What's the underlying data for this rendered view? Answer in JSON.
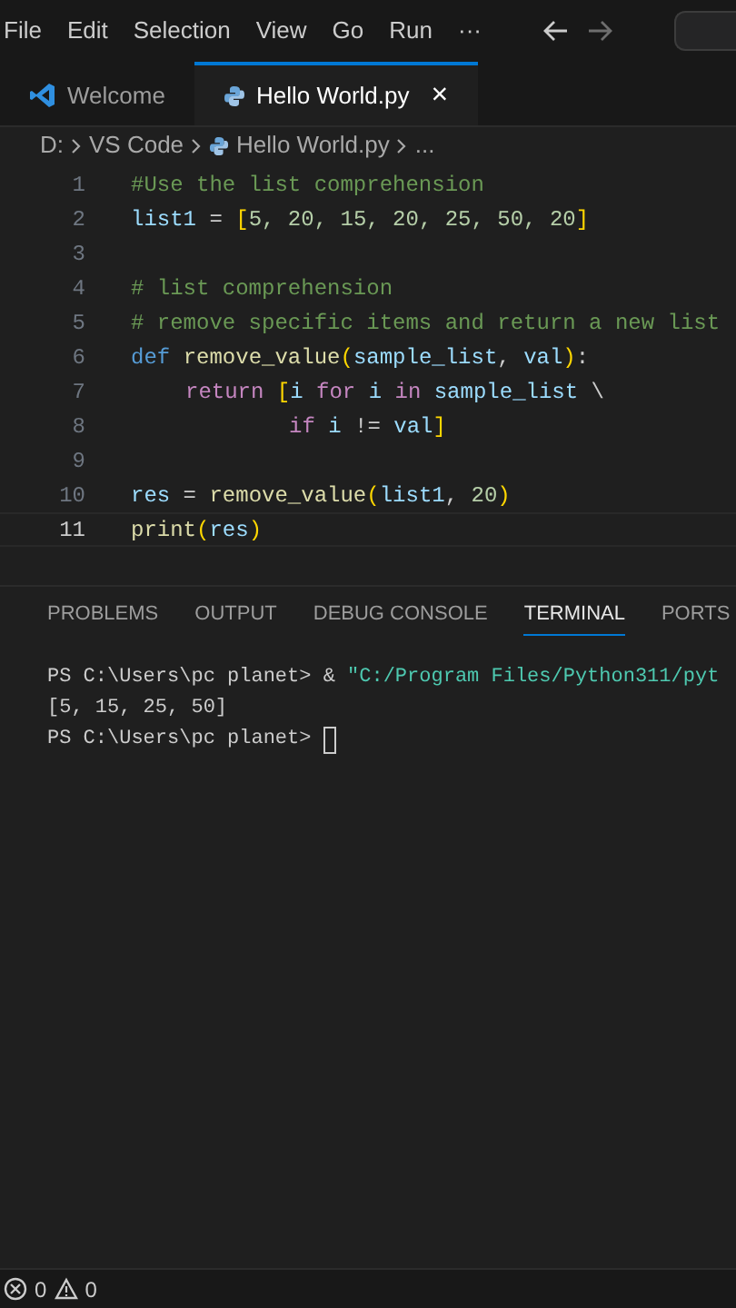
{
  "menu": [
    "File",
    "Edit",
    "Selection",
    "View",
    "Go",
    "Run",
    "···"
  ],
  "tabs": [
    {
      "label": "Welcome",
      "kind": "welcome",
      "selected": false
    },
    {
      "label": "Hello World.py",
      "kind": "python",
      "selected": true,
      "close": "×"
    }
  ],
  "breadcrumb": [
    "D:",
    "VS Code",
    "Hello World.py",
    "..."
  ],
  "code": [
    {
      "number": "1",
      "current": false,
      "tokens": [
        {
          "text": "#Use the list comprehension",
          "kind": "comment"
        }
      ]
    },
    {
      "number": "2",
      "current": false,
      "tokens": [
        {
          "text": "list1",
          "kind": "var"
        },
        {
          "text": " = ",
          "kind": "plain"
        },
        {
          "text": "[",
          "kind": "bracket"
        },
        {
          "text": "5, 20, 15, 20, 25, 50, 20",
          "kind": "number"
        },
        {
          "text": "]",
          "kind": "bracket"
        }
      ]
    },
    {
      "number": "3",
      "current": false
    },
    {
      "number": "4",
      "current": false,
      "tokens": [
        {
          "text": "# list comprehension",
          "kind": "comment"
        }
      ]
    },
    {
      "number": "5",
      "current": false,
      "tokens": [
        {
          "text": "# remove specific items and return a new list",
          "kind": "comment"
        }
      ]
    },
    {
      "number": "6",
      "current": false,
      "tokens": [
        {
          "text": "def ",
          "kind": "keyword"
        },
        {
          "text": "remove_value",
          "kind": "func"
        },
        {
          "text": "(",
          "kind": "bracket"
        },
        {
          "text": "sample_list",
          "kind": "var"
        },
        {
          "text": ", ",
          "kind": "plain"
        },
        {
          "text": "val",
          "kind": "var"
        },
        {
          "text": ")",
          "kind": "bracket"
        },
        {
          "text": ":",
          "kind": "plain"
        }
      ]
    },
    {
      "number": "7",
      "current": false,
      "kind": "body",
      "tokens": [
        {
          "text": "return ",
          "kind": "control"
        },
        {
          "text": "[",
          "kind": "bracket"
        },
        {
          "text": "i ",
          "kind": "var"
        },
        {
          "text": "for ",
          "kind": "control"
        },
        {
          "text": "i ",
          "kind": "var"
        },
        {
          "text": "in ",
          "kind": "control"
        },
        {
          "text": "sample_list",
          "kind": "var"
        },
        {
          "text": " \\",
          "kind": "plain"
        }
      ]
    },
    {
      "number": "8",
      "current": false,
      "kind": "continuation",
      "tokens": [
        {
          "text": "if ",
          "kind": "control"
        },
        {
          "text": "i ",
          "kind": "var"
        },
        {
          "text": "!= ",
          "kind": "plain"
        },
        {
          "text": "val",
          "kind": "var"
        },
        {
          "text": "]",
          "kind": "bracket"
        }
      ]
    },
    {
      "number": "9",
      "current": false
    },
    {
      "number": "10",
      "current": false,
      "tokens": [
        {
          "text": "res",
          "kind": "var"
        },
        {
          "text": " = ",
          "kind": "plain"
        },
        {
          "text": "remove_value",
          "kind": "func"
        },
        {
          "text": "(",
          "kind": "bracket"
        },
        {
          "text": "list1",
          "kind": "var"
        },
        {
          "text": ", ",
          "kind": "plain"
        },
        {
          "text": "20",
          "kind": "number"
        },
        {
          "text": ")",
          "kind": "bracket"
        }
      ]
    },
    {
      "number": "11",
      "current": true,
      "tokens": [
        {
          "text": "print",
          "kind": "func"
        },
        {
          "text": "(",
          "kind": "bracket"
        },
        {
          "text": "res",
          "kind": "var"
        },
        {
          "text": ")",
          "kind": "bracket"
        }
      ]
    }
  ],
  "panel_tabs": [
    {
      "label": "PROBLEMS",
      "selected": false
    },
    {
      "label": "OUTPUT",
      "selected": false
    },
    {
      "label": "DEBUG CONSOLE",
      "selected": false
    },
    {
      "label": "TERMINAL",
      "selected": true
    },
    {
      "label": "PORTS",
      "selected": false
    }
  ],
  "terminal": [
    [
      {
        "text": "PS C:\\Users\\pc planet> & ",
        "kind": "plain"
      },
      {
        "text": "\"C:/Program Files/Python311/pyt",
        "kind": "string"
      }
    ],
    [
      {
        "text": "[5, 15, 25, 50]",
        "kind": "plain"
      }
    ],
    [
      {
        "text": "PS C:\\Users\\pc planet> ",
        "kind": "plain"
      },
      {
        "kind": "cursor"
      }
    ]
  ],
  "status_bar": {
    "errors": "0",
    "warnings": "0"
  }
}
